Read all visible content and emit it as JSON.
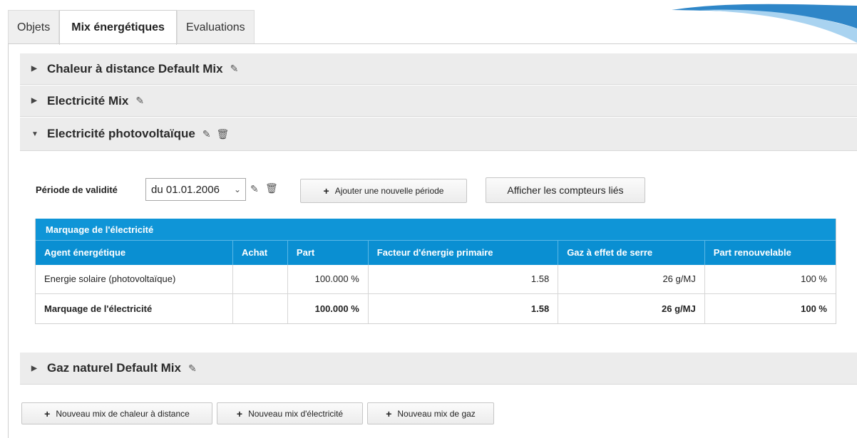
{
  "tabs": [
    {
      "label": "Objets",
      "active": false
    },
    {
      "label": "Mix énergétiques",
      "active": true
    },
    {
      "label": "Evaluations",
      "active": false
    }
  ],
  "accordion": {
    "chaleur": {
      "title": "Chaleur à distance Default Mix",
      "expanded": false
    },
    "electricite": {
      "title": "Electricité Mix",
      "expanded": false
    },
    "photovoltaique": {
      "title": "Electricité photovoltaïque",
      "expanded": true
    },
    "gaz": {
      "title": "Gaz naturel Default Mix",
      "expanded": false
    }
  },
  "period": {
    "label": "Période de validité",
    "selected": "du 01.01.2006",
    "add_button": "Ajouter une nouvelle période",
    "show_meters_button": "Afficher les compteurs liés"
  },
  "table": {
    "title": "Marquage de l'électricité",
    "headers": [
      "Agent énergétique",
      "Achat",
      "Part",
      "Facteur d'énergie primaire",
      "Gaz à effet de serre",
      "Part renouvelable"
    ],
    "rows": [
      [
        "Energie solaire (photovoltaïque)",
        "",
        "100.000 %",
        "1.58",
        "26 g/MJ",
        "100 %"
      ]
    ],
    "total": [
      "Marquage de l'électricité",
      "",
      "100.000 %",
      "1.58",
      "26 g/MJ",
      "100 %"
    ]
  },
  "bottom_buttons": {
    "chaleur": "Nouveau mix de chaleur à distance",
    "electricite": "Nouveau mix d'électricité",
    "gaz": "Nouveau mix de gaz"
  },
  "icons": {
    "edit": "pencil-icon",
    "delete": "trash-icon",
    "collapsed": "triangle-right-icon",
    "expanded": "triangle-down-icon",
    "add": "plus-icon"
  },
  "colors": {
    "table_header": "#0a8fd2",
    "accordion_bg": "#ececec"
  }
}
